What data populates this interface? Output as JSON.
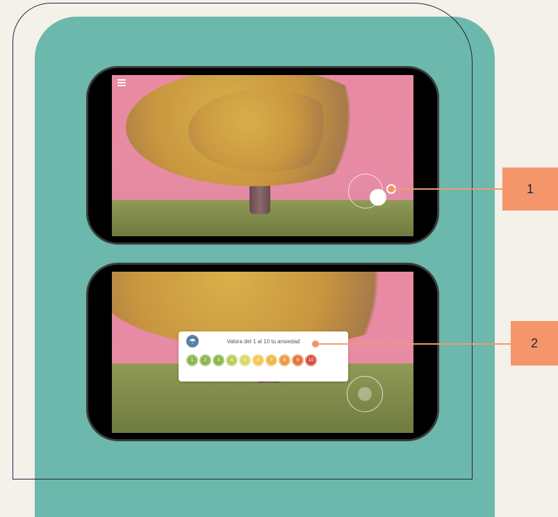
{
  "callouts": [
    {
      "label": "1"
    },
    {
      "label": "2"
    }
  ],
  "rating_dialog": {
    "title": "Valora del 1 al 10 tu ansiedad",
    "logo_icon": "umbrella-icon",
    "options": [
      {
        "label": "1",
        "color": "#8db54e"
      },
      {
        "label": "2",
        "color": "#8db54e"
      },
      {
        "label": "3",
        "color": "#8db54e"
      },
      {
        "label": "4",
        "color": "#b7cf5a"
      },
      {
        "label": "5",
        "color": "#d7d76a"
      },
      {
        "label": "6",
        "color": "#f2c84f"
      },
      {
        "label": "7",
        "color": "#f2b74a"
      },
      {
        "label": "8",
        "color": "#ee9a45"
      },
      {
        "label": "9",
        "color": "#e8733a"
      },
      {
        "label": "10",
        "color": "#d84a3a"
      }
    ]
  },
  "colors": {
    "accent": "#f4956a",
    "panel": "#6cb8ac",
    "sky": "#e98aa3"
  }
}
